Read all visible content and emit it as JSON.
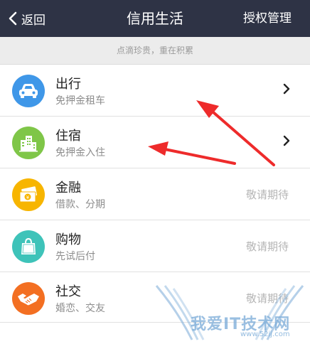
{
  "navbar": {
    "back_label": "返回",
    "title": "信用生活",
    "right_label": "授权管理"
  },
  "subheader": "点滴珍贵，重在积累",
  "rows": [
    {
      "title": "出行",
      "subtitle": "免押金租车",
      "status": "",
      "icon": "car-icon",
      "color": "#3f97e8"
    },
    {
      "title": "住宿",
      "subtitle": "免押金入住",
      "status": "",
      "icon": "building-icon",
      "color": "#7fc648"
    },
    {
      "title": "金融",
      "subtitle": "借款、分期",
      "status": "敬请期待",
      "icon": "money-icon",
      "color": "#f7b500"
    },
    {
      "title": "购物",
      "subtitle": "先试后付",
      "status": "敬请期待",
      "icon": "shopping-bag-icon",
      "color": "#3ec3b9"
    },
    {
      "title": "社交",
      "subtitle": "婚恋、交友",
      "status": "敬请期待",
      "icon": "handshake-icon",
      "color": "#f36f22"
    }
  ],
  "watermark": {
    "text": "我爱IT技术网",
    "url": "www.52ij.com"
  }
}
